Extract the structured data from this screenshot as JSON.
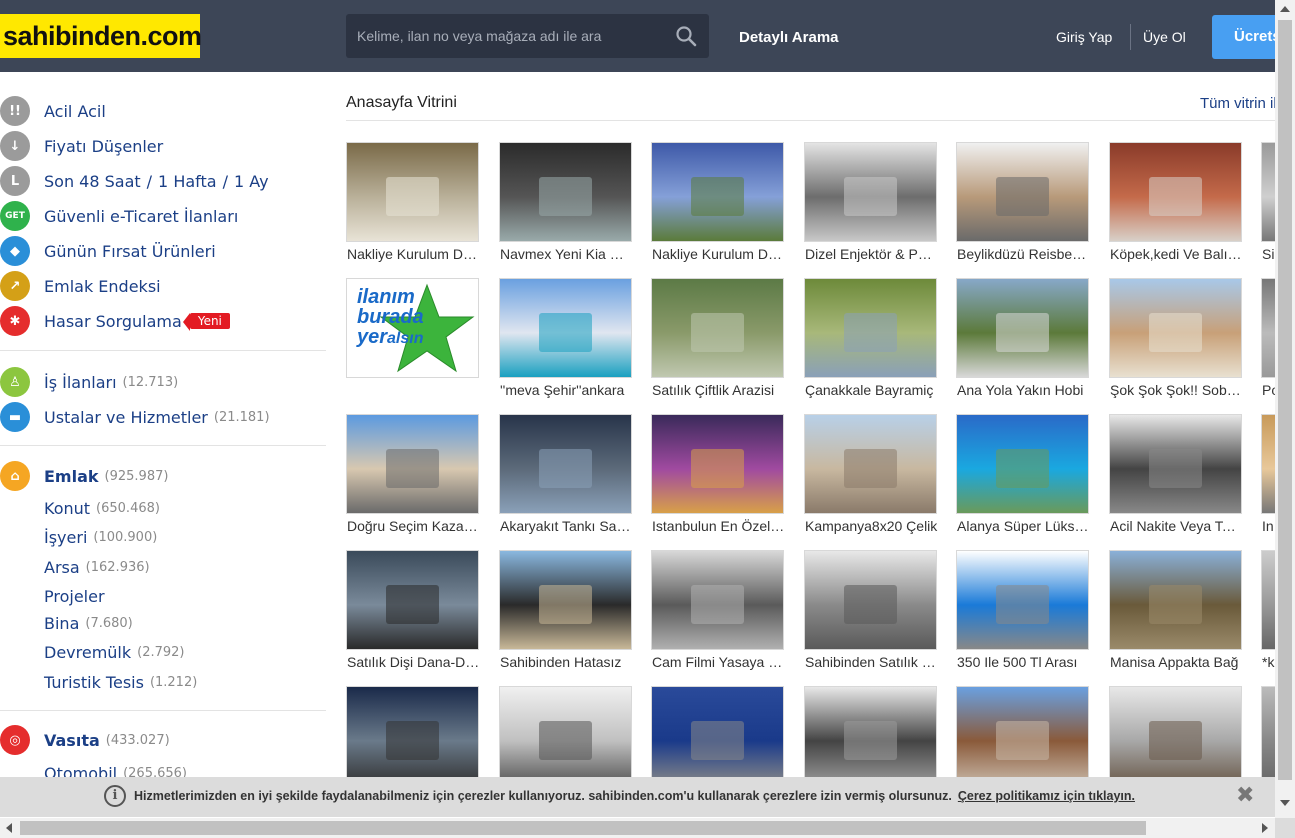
{
  "header": {
    "logo": "sahibinden.com",
    "search_placeholder": "Kelime, ilan no veya mağaza adı ile ara",
    "detailed_search": "Detaylı Arama",
    "login": "Giriş Yap",
    "register": "Üye Ol",
    "cta": "Ücretsiz"
  },
  "sidebar": {
    "quick": [
      {
        "label": "Acil Acil",
        "icon": "exclamation-icon",
        "color": "#9b9b9b",
        "glyph": "!!"
      },
      {
        "label": "Fiyatı Düşenler",
        "icon": "down-arrow-icon",
        "color": "#9b9b9b",
        "glyph": "↓"
      },
      {
        "label": "Son 48 Saat",
        "icon": "clock-icon",
        "color": "#9b9b9b",
        "glyph": "L"
      },
      {
        "label": "Güvenli e-Ticaret İlanları",
        "icon": "get-icon",
        "color": "#2fb24c",
        "glyph": "GET"
      },
      {
        "label": "Günün Fırsat Ürünleri",
        "icon": "tag-icon",
        "color": "#2a8fd8",
        "glyph": "◆"
      },
      {
        "label": "Emlak Endeksi",
        "icon": "chart-icon",
        "color": "#d4a017",
        "glyph": "↗"
      },
      {
        "label": "Hasar Sorgulama",
        "icon": "car-damage-icon",
        "color": "#e52d2d",
        "glyph": "✱"
      }
    ],
    "time_links": {
      "week": "1 Hafta",
      "month": "1 Ay",
      "separator": "/"
    },
    "badge_new": "Yeni",
    "jobs": {
      "label": "İş İlanları",
      "count": "(12.713)",
      "icon": "person-icon",
      "color": "#8cc63f"
    },
    "services": {
      "label": "Ustalar ve Hizmetler",
      "count": "(21.181)",
      "icon": "paint-roller-icon",
      "color": "#2a8fd8"
    },
    "emlak": {
      "label": "Emlak",
      "count": "(925.987)",
      "icon": "house-icon",
      "color": "#f5a623",
      "subs": [
        {
          "label": "Konut",
          "count": "(650.468)"
        },
        {
          "label": "İşyeri",
          "count": "(100.900)"
        },
        {
          "label": "Arsa",
          "count": "(162.936)"
        },
        {
          "label": "Projeler",
          "count": ""
        },
        {
          "label": "Bina",
          "count": "(7.680)"
        },
        {
          "label": "Devremülk",
          "count": "(2.792)"
        },
        {
          "label": "Turistik Tesis",
          "count": "(1.212)"
        }
      ]
    },
    "vasita": {
      "label": "Vasıta",
      "count": "(433.027)",
      "icon": "steering-wheel-icon",
      "color": "#e52d2d",
      "subs": [
        {
          "label": "Otomobil",
          "count": "(265.656)"
        }
      ]
    }
  },
  "main": {
    "title": "Anasayfa Vitrini",
    "all_link": "Tüm vitrin ilanları",
    "rows": [
      [
        "Nakliye Kurulum Dahil",
        "Navmex Yeni Kia Sportage",
        "Nakliye Kurulum Dahil",
        "Dizel Enjektör & Pompa",
        "Beylikdüzü Reisbey Sitesi",
        "Köpek,kedi Ve Balık Yemi",
        "Si"
      ],
      [
        "",
        "''meva Şehir''ankara",
        "Satılık Çiftlik Arazisi",
        "Çanakkale Bayramiç",
        "Ana Yola Yakın Hobi",
        "Şok Şok Şok!! Sobacı",
        "Po"
      ],
      [
        "Doğru Seçim Kazandırır",
        "Akaryakıt Tankı Satılık",
        "Istanbulun En Özel Mekanı",
        "Kampanya8x20 Çelik",
        "Alanya Süper Lüks Daire",
        "Acil Nakite Veya Takas",
        "In"
      ],
      [
        "Satılık Dişi Dana-Düve",
        "Sahibinden Hatasız",
        "Cam Filmi Yasaya Uygun",
        "Sahibinden Satılık Daire",
        "350 Ile 500 Tl Arası",
        "Manisa Appakta Bağ",
        "*k"
      ],
      [
        "",
        "",
        "",
        "",
        "",
        "",
        ""
      ]
    ],
    "placeholder_ad": {
      "line1": "ilanım",
      "line2": "burada",
      "line3": "yer",
      "line4": "alsın"
    }
  },
  "cookie_bar": {
    "text": "Hizmetlerimizden en iyi şekilde faydalanabilmeniz için çerezler kullanıyoruz. sahibinden.com'u kullanarak çerezlere izin vermiş olursunuz.",
    "link": "Çerez politikamız için tıklayın.",
    "close": "✖"
  }
}
